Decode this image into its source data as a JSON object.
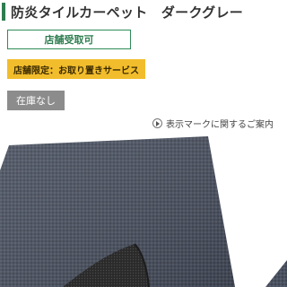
{
  "product": {
    "title": "防炎タイルカーペット　ダークグレー"
  },
  "badges": {
    "store_pickup": "店舗受取可",
    "store_service": "店舗限定：お取り置きサービス",
    "stock_status": "在庫なし"
  },
  "info_link": {
    "label": "表示マークに関するご案内",
    "icon": "circle-play-icon"
  },
  "colors": {
    "accent_green": "#2e7d4f",
    "service_yellow": "#f2bd2c",
    "stock_gray": "#8c8c8c",
    "carpet_gray": "#4a5160"
  }
}
